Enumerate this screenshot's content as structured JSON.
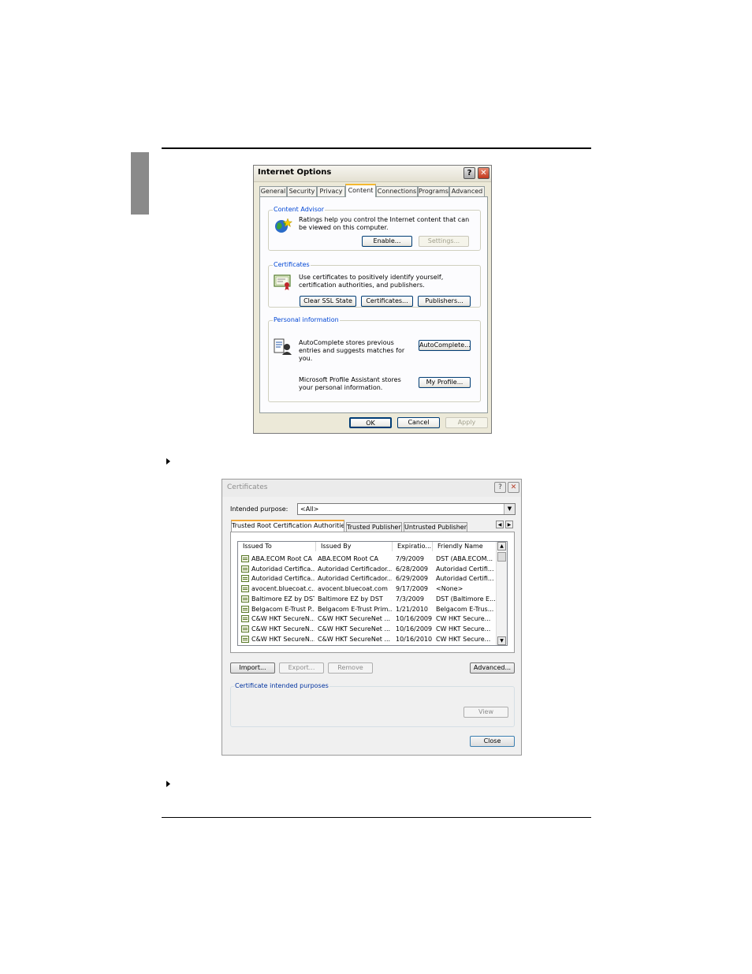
{
  "internet_options": {
    "title": "Internet Options",
    "help_glyph": "?",
    "close_glyph": "✕",
    "tabs": [
      "General",
      "Security",
      "Privacy",
      "Content",
      "Connections",
      "Programs",
      "Advanced"
    ],
    "selected_tab": "Content",
    "content_advisor": {
      "label": "Content Advisor",
      "text": "Ratings help you control the Internet content that can be viewed on this computer.",
      "enable": "Enable...",
      "settings": "Settings..."
    },
    "certificates": {
      "label": "Certificates",
      "text": "Use certificates to positively identify yourself, certification authorities, and publishers.",
      "clear_ssl": "Clear SSL State",
      "certificates": "Certificates...",
      "publishers": "Publishers..."
    },
    "personal": {
      "label": "Personal information",
      "autocomplete_text": "AutoComplete stores previous entries and suggests matches for you.",
      "autocomplete_btn": "AutoComplete...",
      "profile_text": "Microsoft Profile Assistant stores your personal information.",
      "profile_btn": "My Profile..."
    },
    "ok": "OK",
    "cancel": "Cancel",
    "apply": "Apply"
  },
  "certificates_dialog": {
    "title": "Certificates",
    "help_glyph": "?",
    "close_glyph": "✕",
    "intended_purpose_label": "Intended purpose:",
    "intended_purpose_value": "<All>",
    "tabs": [
      "Trusted Root Certification Authorities",
      "Trusted Publishers",
      "Untrusted Publishers"
    ],
    "columns": [
      "Issued To",
      "Issued By",
      "Expiratio...",
      "Friendly Name"
    ],
    "rows": [
      [
        "ABA.ECOM Root CA",
        "ABA.ECOM Root CA",
        "7/9/2009",
        "DST (ABA.ECOM..."
      ],
      [
        "Autoridad Certifica...",
        "Autoridad Certificador...",
        "6/28/2009",
        "Autoridad Certifi..."
      ],
      [
        "Autoridad Certifica...",
        "Autoridad Certificador...",
        "6/29/2009",
        "Autoridad Certifi..."
      ],
      [
        "avocent.bluecoat.c...",
        "avocent.bluecoat.com",
        "9/17/2009",
        "<None>"
      ],
      [
        "Baltimore EZ by DST",
        "Baltimore EZ by DST",
        "7/3/2009",
        "DST (Baltimore E..."
      ],
      [
        "Belgacom E-Trust P...",
        "Belgacom E-Trust Prim...",
        "1/21/2010",
        "Belgacom E-Trus..."
      ],
      [
        "C&W HKT SecureN...",
        "C&W HKT SecureNet ...",
        "10/16/2009",
        "CW HKT Secure..."
      ],
      [
        "C&W HKT SecureN...",
        "C&W HKT SecureNet ...",
        "10/16/2009",
        "CW HKT Secure..."
      ],
      [
        "C&W HKT SecureN...",
        "C&W HKT SecureNet ...",
        "10/16/2010",
        "CW HKT Secure..."
      ]
    ],
    "import": "Import...",
    "export": "Export...",
    "remove": "Remove",
    "advanced": "Advanced...",
    "purposes_label": "Certificate intended purposes",
    "view": "View",
    "close": "Close"
  }
}
